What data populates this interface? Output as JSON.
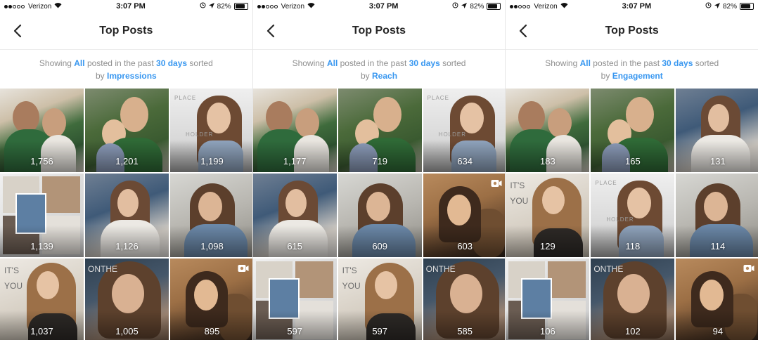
{
  "screens": [
    {
      "status": {
        "carrier": "Verizon",
        "time": "3:07 PM",
        "battery": "82%"
      },
      "title": "Top Posts",
      "caption": {
        "prefix": "Showing",
        "filter": "All",
        "middle": "posted in the past",
        "period": "30 days",
        "sorted": "sorted",
        "by": "by",
        "metric": "Impressions"
      },
      "posts": [
        {
          "count": "1,756",
          "photo": "couple"
        },
        {
          "count": "1,201",
          "photo": "kid"
        },
        {
          "count": "1,199",
          "photo": "place"
        },
        {
          "count": "1,139",
          "photo": "collage"
        },
        {
          "count": "1,126",
          "photo": "pensive"
        },
        {
          "count": "1,098",
          "photo": "denim"
        },
        {
          "count": "1,037",
          "photo": "blonde"
        },
        {
          "count": "1,005",
          "photo": "closeup"
        },
        {
          "count": "895",
          "photo": "video"
        }
      ]
    },
    {
      "status": {
        "carrier": "Verizon",
        "time": "3:07 PM",
        "battery": "82%"
      },
      "title": "Top Posts",
      "caption": {
        "prefix": "Showing",
        "filter": "All",
        "middle": "posted in the past",
        "period": "30 days",
        "sorted": "sorted",
        "by": "by",
        "metric": "Reach"
      },
      "posts": [
        {
          "count": "1,177",
          "photo": "couple"
        },
        {
          "count": "719",
          "photo": "kid"
        },
        {
          "count": "634",
          "photo": "place"
        },
        {
          "count": "615",
          "photo": "pensive"
        },
        {
          "count": "609",
          "photo": "denim"
        },
        {
          "count": "603",
          "photo": "video"
        },
        {
          "count": "597",
          "photo": "collage"
        },
        {
          "count": "597",
          "photo": "blonde"
        },
        {
          "count": "585",
          "photo": "closeup"
        }
      ]
    },
    {
      "status": {
        "carrier": "Verizon",
        "time": "3:07 PM",
        "battery": "82%"
      },
      "title": "Top Posts",
      "caption": {
        "prefix": "Showing",
        "filter": "All",
        "middle": "posted in the past",
        "period": "30 days",
        "sorted": "sorted",
        "by": "by",
        "metric": "Engagement"
      },
      "posts": [
        {
          "count": "183",
          "photo": "couple"
        },
        {
          "count": "165",
          "photo": "kid"
        },
        {
          "count": "131",
          "photo": "pensive"
        },
        {
          "count": "129",
          "photo": "blonde"
        },
        {
          "count": "118",
          "photo": "place"
        },
        {
          "count": "114",
          "photo": "denim"
        },
        {
          "count": "106",
          "photo": "collage"
        },
        {
          "count": "102",
          "photo": "closeup"
        },
        {
          "count": "94",
          "photo": "video"
        }
      ]
    }
  ],
  "overlay_text": {
    "place_top": "PLACE",
    "place_bottom": "HOLDER",
    "its_you": "IT'S YOU",
    "on_the": "ONTHE"
  },
  "icons": {
    "back": "chevron-left-icon",
    "video": "video-camera-icon",
    "wifi": "wifi-icon",
    "location": "location-arrow-icon",
    "alarm": "alarm-icon",
    "battery": "battery-icon"
  },
  "colors": {
    "link": "#3897f0",
    "caption": "#8e8e8e",
    "title": "#262626"
  }
}
